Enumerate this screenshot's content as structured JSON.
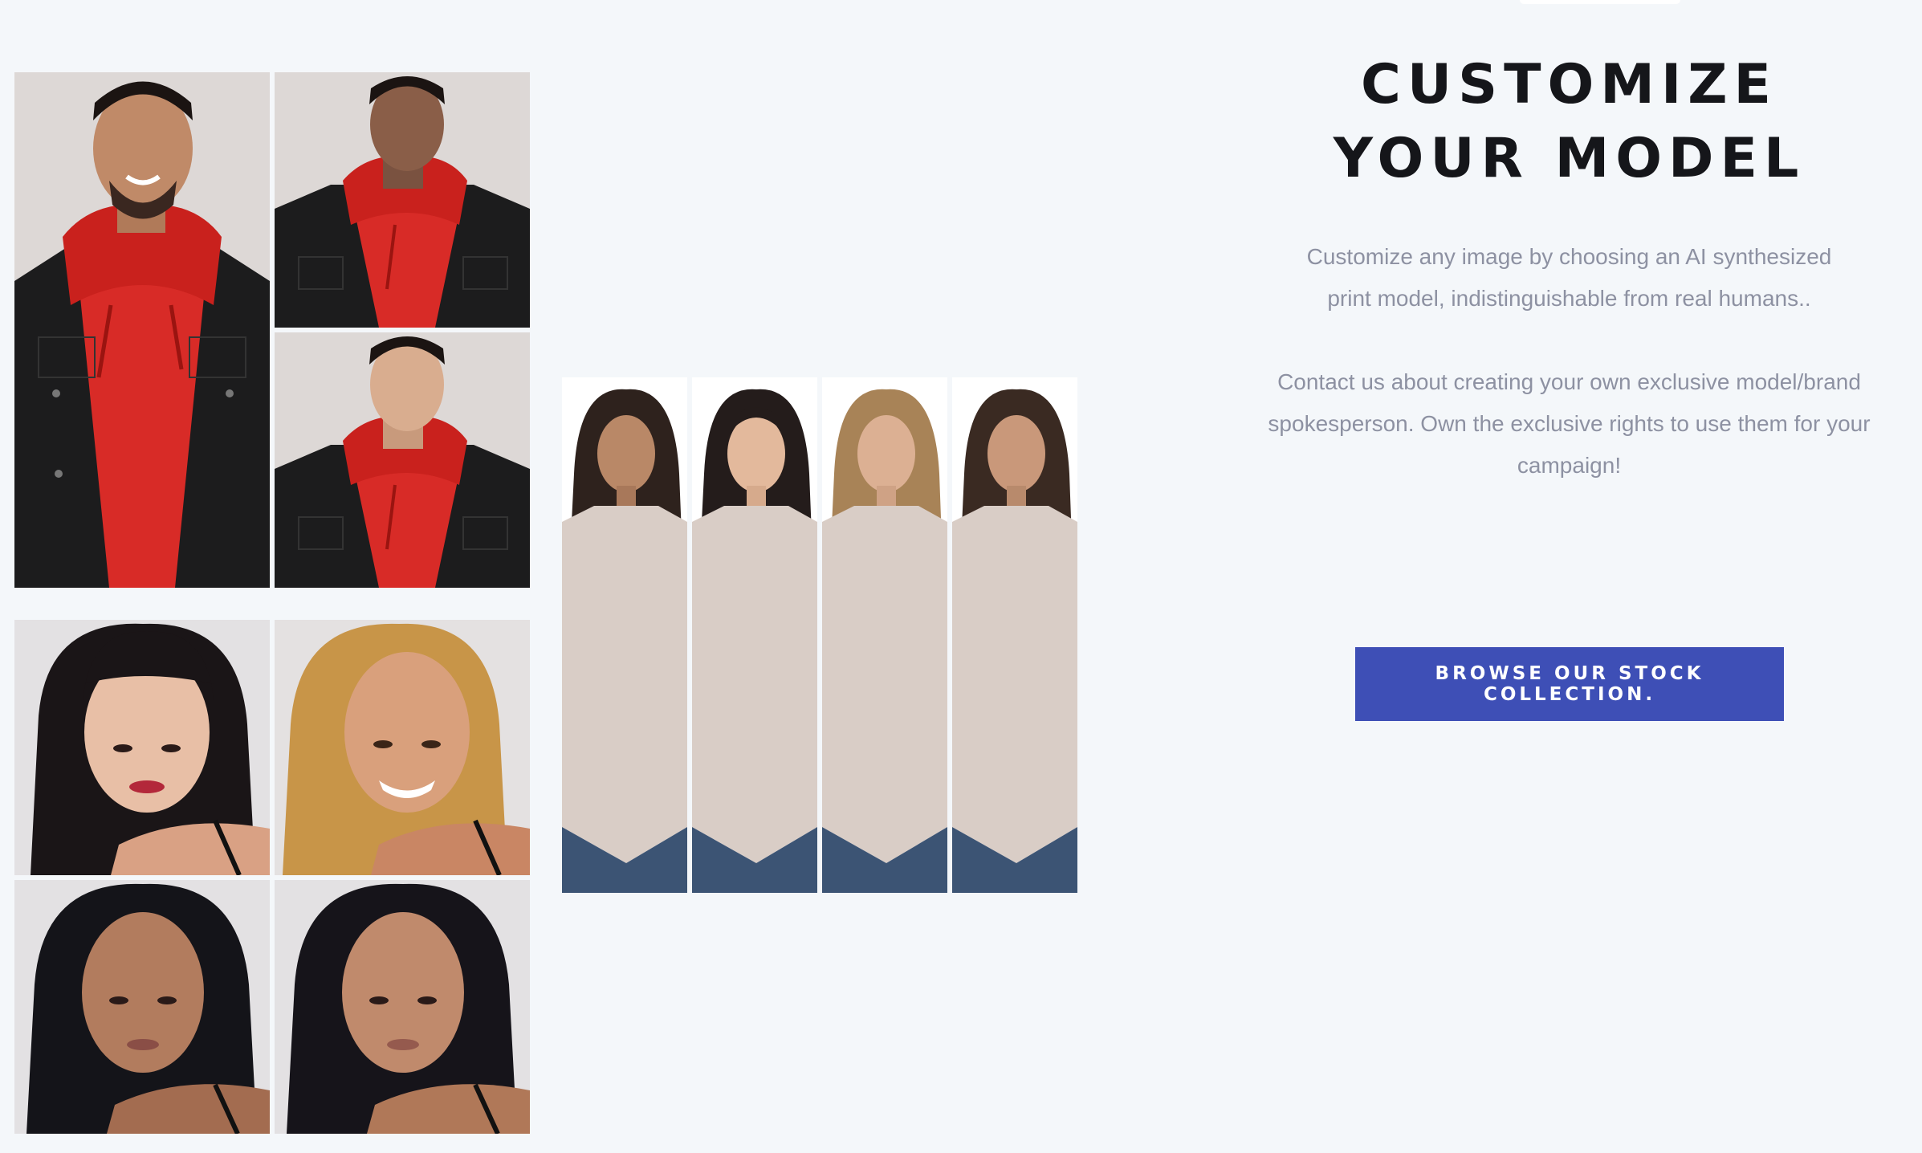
{
  "header_tab": "",
  "section": {
    "title": "CUSTOMIZE YOUR MODEL",
    "paragraph1": "Customize any image by choosing an AI synthesized print model, indistinguishable from real humans..",
    "paragraph2": "Contact us about creating your own exclusive model/brand spokesperson. Own the exclusive rights to use them for your campaign!",
    "cta_label": "BROWSE OUR STOCK COLLECTION."
  },
  "gallery": {
    "male_group": [
      "male-model-red-hoodie-smiling",
      "male-model-red-hoodie-side",
      "male-model-red-hoodie-asian"
    ],
    "female_portraits": [
      "female-portrait-bangs",
      "female-portrait-blonde",
      "female-portrait-dark-hair",
      "female-portrait-dark-hair-2"
    ],
    "sweater_strip": [
      "sweater-model-1",
      "sweater-model-2",
      "sweater-model-3",
      "sweater-model-4"
    ]
  },
  "colors": {
    "background": "#f4f7fa",
    "button": "#3e4fb6",
    "title": "#15161a",
    "body_text": "#8d91a2"
  }
}
